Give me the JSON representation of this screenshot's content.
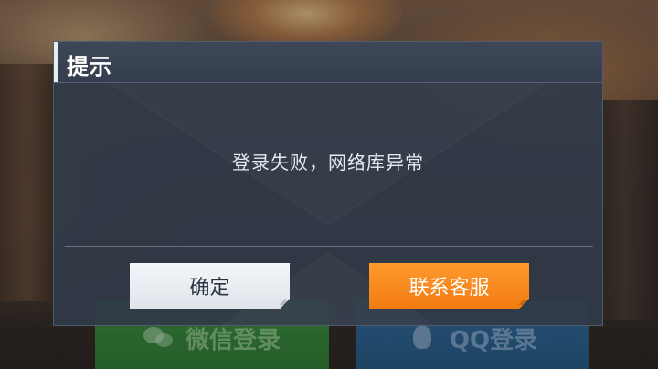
{
  "dialog": {
    "title": "提示",
    "message": "登录失败，网络库异常",
    "confirm_label": "确定",
    "support_label": "联系客服"
  },
  "background": {
    "wechat_login_label": "微信登录",
    "qq_login_label": "QQ登录"
  },
  "colors": {
    "dialog_bg": "#303a48",
    "confirm_bg": "#eef1f5",
    "support_bg": "#f7891f",
    "wechat_green": "#3e9a3b",
    "qq_blue": "#2f6fa3"
  },
  "icons": {
    "wechat": "wechat-icon",
    "qq": "qq-penguin-icon"
  }
}
